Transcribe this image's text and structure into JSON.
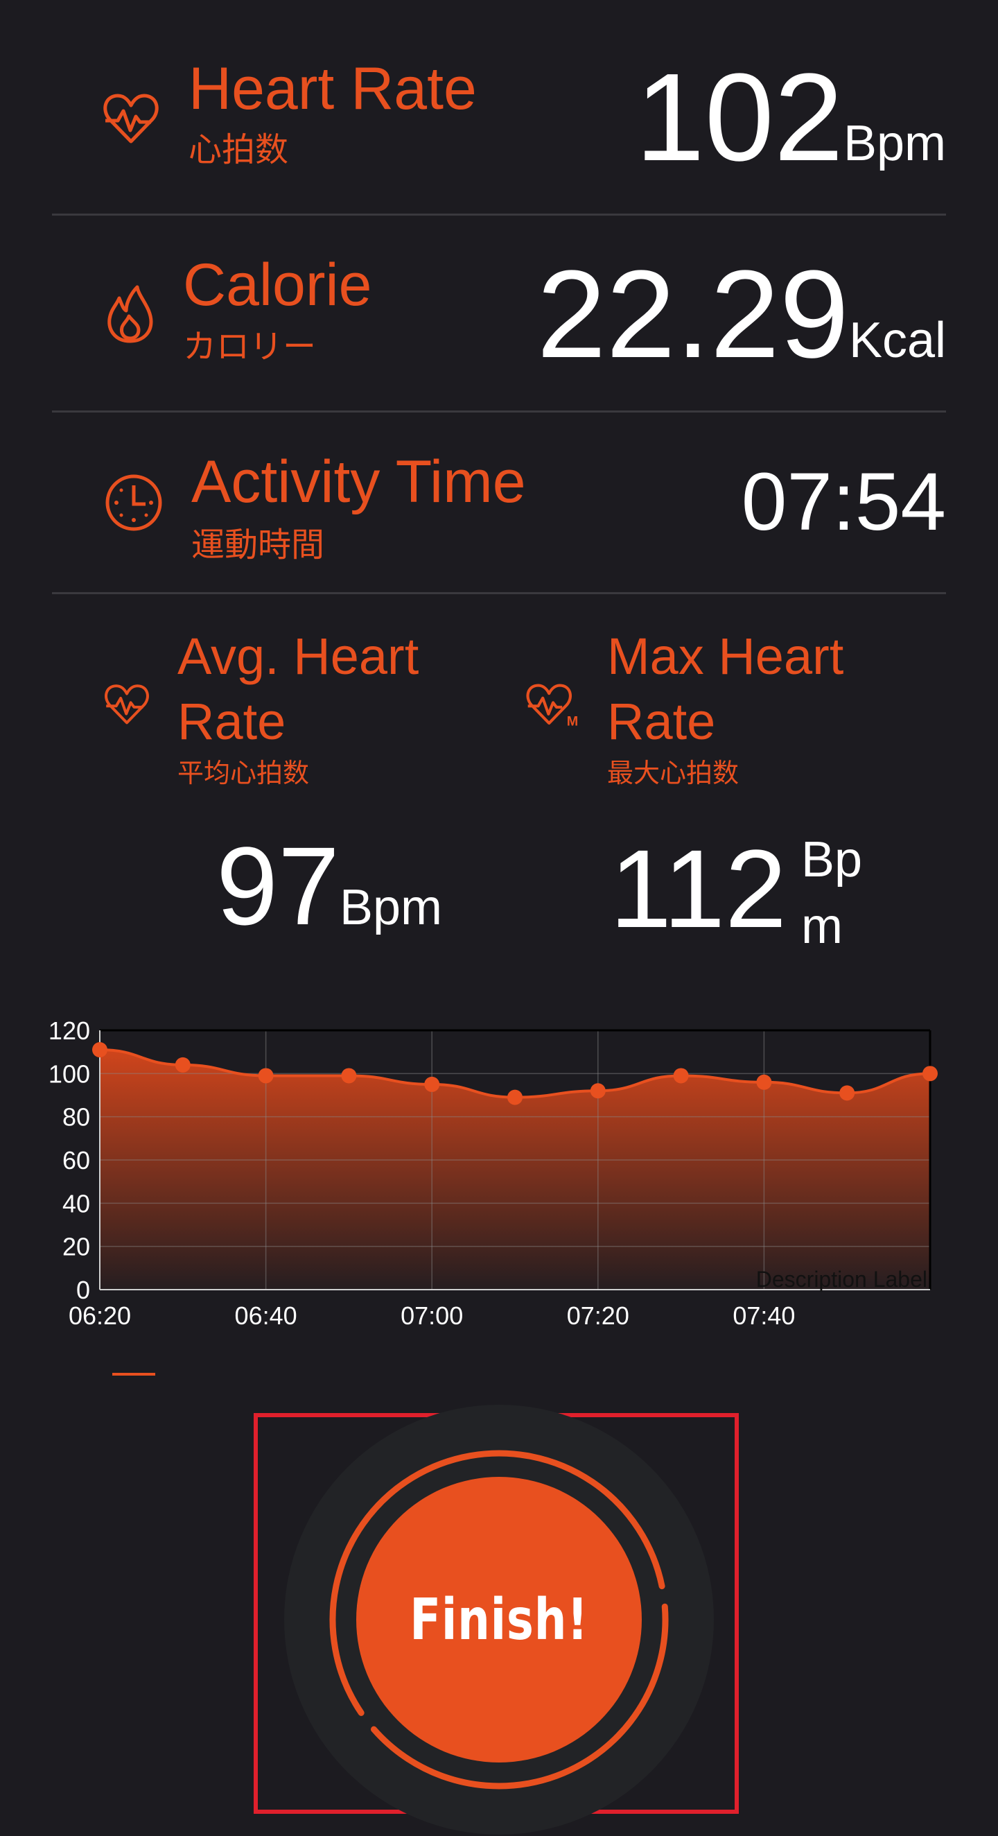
{
  "colors": {
    "accent": "#e8501f",
    "background": "#1c1b20",
    "divider": "#3a393e",
    "highlight_box": "#e0202c"
  },
  "heart_rate": {
    "title": "Heart Rate",
    "subtitle": "心拍数",
    "value": "102",
    "unit": "Bpm",
    "icon": "heart-pulse-icon"
  },
  "calorie": {
    "title": "Calorie",
    "subtitle": "カロリー",
    "value": "22.29",
    "unit": "Kcal",
    "icon": "flame-icon"
  },
  "activity_time": {
    "title": "Activity Time",
    "subtitle": "運動時間",
    "value": "07:54",
    "icon": "clock-icon"
  },
  "avg_heart_rate": {
    "title_line1": "Avg. Heart",
    "title_line2": "Rate",
    "subtitle": "平均心拍数",
    "value": "97",
    "unit": "Bpm",
    "icon": "heart-pulse-icon"
  },
  "max_heart_rate": {
    "title_line1": "Max Heart",
    "title_line2": "Rate",
    "subtitle": "最大心拍数",
    "value": "112",
    "unit_line1": "Bp",
    "unit_line2": "m",
    "icon": "heart-max-icon"
  },
  "chart_data": {
    "type": "area",
    "x": [
      "06:20",
      "06:30",
      "06:40",
      "06:50",
      "07:00",
      "07:10",
      "07:20",
      "07:30",
      "07:40",
      "07:50",
      "08:00"
    ],
    "xticks": [
      "06:20",
      "06:40",
      "07:00",
      "07:20",
      "07:40"
    ],
    "values": [
      111,
      104,
      99,
      99,
      95,
      89,
      92,
      99,
      96,
      91,
      100
    ],
    "yticks": [
      "0",
      "20",
      "40",
      "60",
      "80",
      "100",
      "120"
    ],
    "ylim": [
      0,
      120
    ],
    "description_label": "Description Label",
    "grid": true
  },
  "finish_button": {
    "label": "Finish!"
  }
}
